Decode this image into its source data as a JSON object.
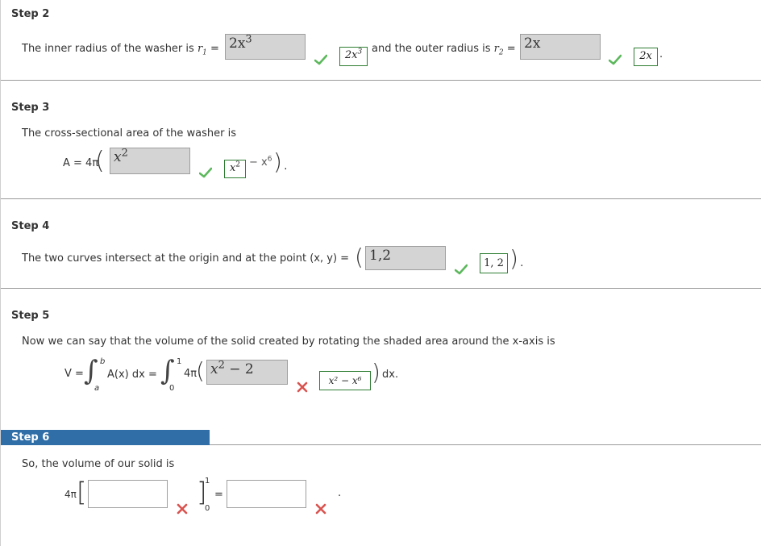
{
  "step2": {
    "label": "Step 2",
    "text_inner": "The inner radius of the washer is",
    "r1_var": "r",
    "r1_sub": "1",
    "eq": "=",
    "inner_input_value": "2x",
    "inner_input_sup": "3",
    "inner_answer": "2x",
    "inner_answer_sup": "3",
    "text_outer": "and the outer radius is",
    "r2_var": "r",
    "r2_sub": "2",
    "outer_input_value": "2x",
    "outer_answer": "2x",
    "period": "."
  },
  "step3": {
    "label": "Step 3",
    "text": "The cross-sectional area of the washer is",
    "lhs": "A = 4π",
    "input_value": "x",
    "input_sup": "2",
    "answer": "x",
    "answer_sup": "2",
    "tail": "− x",
    "tail_sup": "6"
  },
  "step4": {
    "label": "Step 4",
    "text": "The two curves intersect at the origin and at the point (x, y) =",
    "input_value": "1,2",
    "answer": "1, 2"
  },
  "step5": {
    "label": "Step 5",
    "text": "Now we can say that the volume of the solid created by rotating the shaded area around the x-axis is",
    "v_eq": "V =",
    "int_upper1": "b",
    "int_lower1": "a",
    "integrand1": "A(x) dx =",
    "int_upper2": "1",
    "int_lower2": "0",
    "coef": "4π",
    "input_value": "x",
    "input_sup": "2",
    "input_tail": " − 2",
    "answer": "x² − x⁶",
    "dx": "dx."
  },
  "step6": {
    "label": "Step 6",
    "text": "So, the volume of our solid is",
    "coef": "4π",
    "eval_upper": "1",
    "eval_lower": "0",
    "eq": "=",
    "period": "."
  },
  "colors": {
    "check_green": "#5cb85c",
    "cross_red": "#d9534f",
    "step6_bar": "#2f6ea7",
    "answer_border": "#2e7d32"
  },
  "icons": {
    "correct": "check-icon",
    "incorrect": "cross-icon"
  }
}
